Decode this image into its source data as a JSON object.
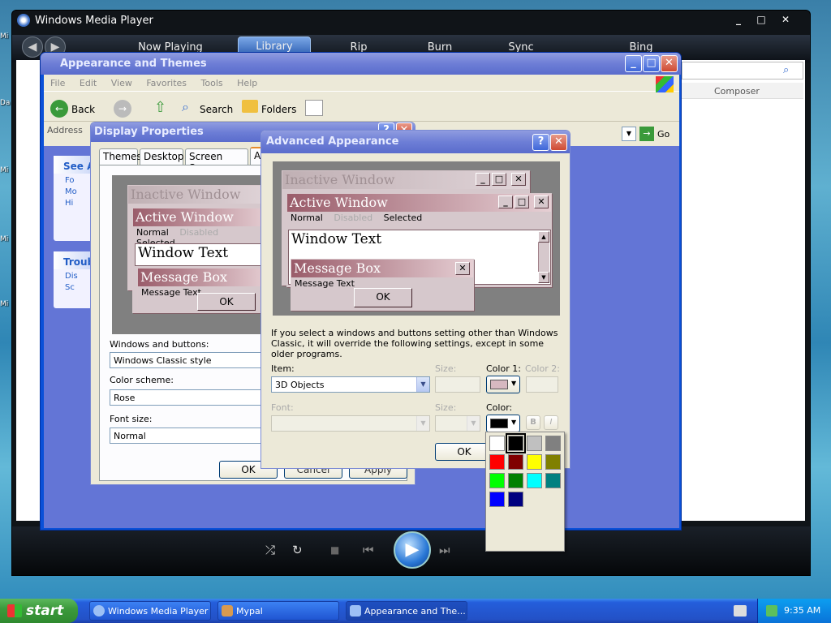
{
  "desktop": {
    "icons": [
      "Mi",
      "Da",
      "Mi",
      "Mi",
      "Mi"
    ]
  },
  "wmp": {
    "title": "Windows Media Player",
    "tabs": [
      "Now Playing",
      "Library",
      "Rip",
      "Burn",
      "Sync",
      "Bing"
    ],
    "active_tab": "Library",
    "column_composer": "Composer",
    "controls": {
      "shuffle": "⤮",
      "repeat": "↻",
      "stop": "■",
      "prev": "⏮",
      "play": "▶",
      "next": "⏭"
    }
  },
  "explorer": {
    "title": "Appearance and Themes",
    "menu": [
      "File",
      "Edit",
      "View",
      "Favorites",
      "Tools",
      "Help"
    ],
    "toolbar": {
      "back": "Back",
      "search": "Search",
      "folders": "Folders"
    },
    "address_label": "Address",
    "go_label": "Go",
    "see_also": {
      "title": "See Al",
      "items": [
        "Fo",
        "Mo",
        "Hi"
      ]
    },
    "troubleshooters": {
      "title": "Troub",
      "items": [
        "Dis",
        "Sc"
      ]
    }
  },
  "display_properties": {
    "title": "Display Properties",
    "tabs": [
      "Themes",
      "Desktop",
      "Screen Saver",
      "Ap"
    ],
    "preview": {
      "inactive": "Inactive Window",
      "active": "Active Window",
      "menu": [
        "Normal",
        "Disabled",
        "Selected"
      ],
      "window_text": "Window Text",
      "message_box": "Message Box",
      "message_text": "Message Text",
      "ok": "OK"
    },
    "windows_buttons_label": "Windows and buttons:",
    "windows_buttons_value": "Windows Classic style",
    "color_scheme_label": "Color scheme:",
    "color_scheme_value": "Rose",
    "font_size_label": "Font size:",
    "font_size_value": "Normal",
    "buttons": {
      "ok": "OK",
      "cancel": "Cancel",
      "apply": "Apply"
    }
  },
  "advanced": {
    "title": "Advanced Appearance",
    "preview": {
      "inactive": "Inactive Window",
      "active": "Active Window",
      "menu": [
        "Normal",
        "Disabled",
        "Selected"
      ],
      "window_text": "Window Text",
      "message_box": "Message Box",
      "message_text": "Message Text",
      "ok": "OK"
    },
    "info": "If you select a windows and buttons setting other than Windows Classic, it will override the following settings, except in some older programs.",
    "item_label": "Item:",
    "item_value": "3D Objects",
    "size_label": "Size:",
    "color1_label": "Color 1:",
    "color2_label": "Color 2:",
    "font_label": "Font:",
    "size2_label": "Size:",
    "color_label": "Color:",
    "bold": "B",
    "italic": "I",
    "ok": "OK",
    "color1_value": "#d6b8c0",
    "color_value": "#000000"
  },
  "palette": {
    "colors": [
      "#ffffff",
      "#000000",
      "#c0c0c0",
      "#808080",
      "#ff0000",
      "#800000",
      "#ffff00",
      "#808000",
      "#00ff00",
      "#008000",
      "#00ffff",
      "#008080",
      "#0000ff",
      "#000080"
    ]
  },
  "taskbar": {
    "start": "start",
    "tasks": [
      "Windows Media Player",
      "Mypal",
      "Appearance and The..."
    ],
    "time": "9:35 AM"
  }
}
